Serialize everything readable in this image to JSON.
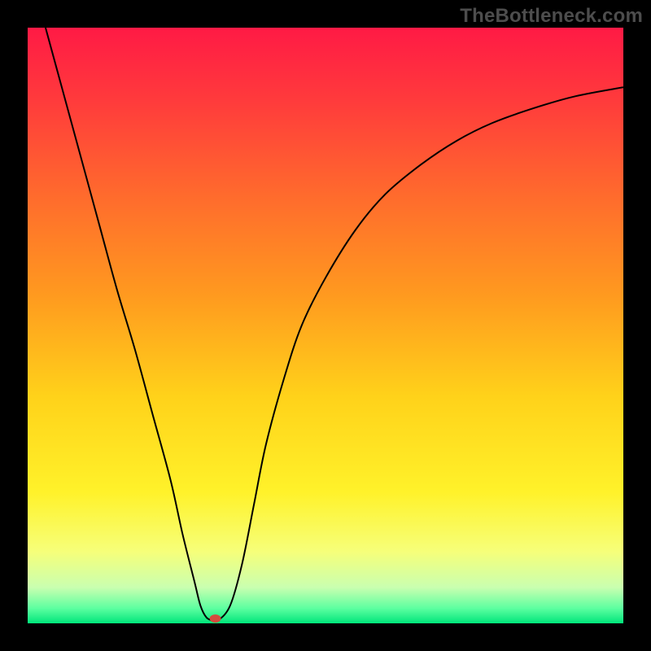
{
  "watermark": "TheBottleneck.com",
  "chart_data": {
    "type": "line",
    "title": "",
    "xlabel": "",
    "ylabel": "",
    "xlim": [
      0,
      100
    ],
    "ylim": [
      0,
      100
    ],
    "background_gradient": {
      "stops": [
        {
          "offset": 0.0,
          "color": "#ff1a45"
        },
        {
          "offset": 0.12,
          "color": "#ff3a3c"
        },
        {
          "offset": 0.28,
          "color": "#ff6a2d"
        },
        {
          "offset": 0.45,
          "color": "#ff9a1f"
        },
        {
          "offset": 0.62,
          "color": "#ffd21a"
        },
        {
          "offset": 0.78,
          "color": "#fff22a"
        },
        {
          "offset": 0.88,
          "color": "#f6ff7a"
        },
        {
          "offset": 0.94,
          "color": "#c9ffb0"
        },
        {
          "offset": 0.975,
          "color": "#5cffa0"
        },
        {
          "offset": 1.0,
          "color": "#00e57a"
        }
      ]
    },
    "series": [
      {
        "name": "bottleneck-curve",
        "color": "#000000",
        "stroke_width": 2,
        "x": [
          3,
          6,
          9,
          12,
          15,
          18,
          21,
          24,
          26,
          28,
          29,
          30,
          31,
          32,
          34,
          36,
          38,
          40,
          43,
          46,
          50,
          55,
          60,
          66,
          72,
          78,
          85,
          92,
          100
        ],
        "y": [
          100,
          89,
          78,
          67,
          56,
          46,
          35,
          24,
          15,
          7,
          3,
          1,
          0.5,
          0.5,
          3,
          10,
          20,
          30,
          41,
          50,
          58,
          66,
          72,
          77,
          81,
          84,
          86.5,
          88.5,
          90
        ]
      }
    ],
    "marker": {
      "name": "min-point",
      "x": 31.5,
      "y": 0.8,
      "rx": 7,
      "ry": 5,
      "color": "#d44b3e"
    }
  }
}
